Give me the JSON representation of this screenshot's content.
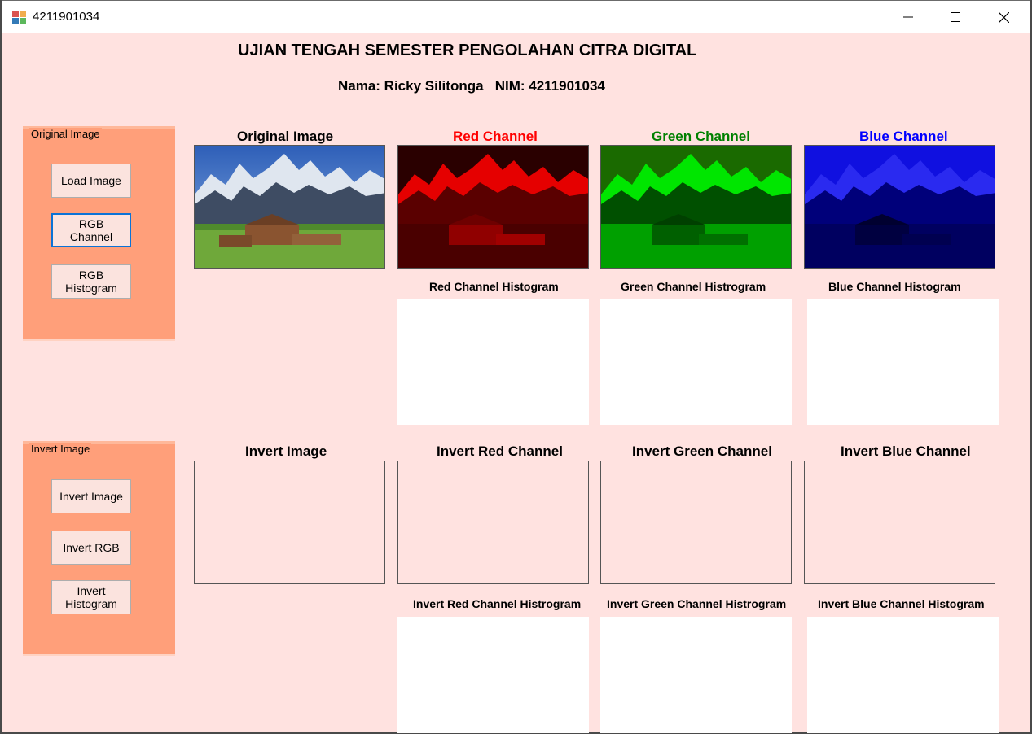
{
  "window": {
    "title": "4211901034"
  },
  "header": {
    "title": "UJIAN TENGAH SEMESTER PENGOLAHAN CITRA DIGITAL",
    "subtitle": "Nama: Ricky Silitonga   NIM: 4211901034"
  },
  "group_original": {
    "legend": "Original Image",
    "buttons": [
      "Load Image",
      "RGB Channel",
      "RGB Histogram"
    ]
  },
  "group_invert": {
    "legend": "Invert Image",
    "buttons": [
      "Invert Image",
      "Invert RGB",
      "Invert Histogram"
    ]
  },
  "captions": {
    "original": "Original Image",
    "red": "Red Channel",
    "green": "Green Channel",
    "blue": "Blue Channel",
    "red_hist": "Red Channel Histogram",
    "green_hist": "Green Channel Histrogram",
    "blue_hist": "Blue Channel Histogram",
    "invert": "Invert Image",
    "invert_red": "Invert Red Channel",
    "invert_green": "Invert Green Channel",
    "invert_blue": "Invert Blue Channel",
    "invert_red_hist": "Invert Red Channel Histrogram",
    "invert_green_hist": "Invert Green Channel Histrogram",
    "invert_blue_hist": "Invert Blue Channel Histogram"
  },
  "colors": {
    "form_bg": "#ffe2e0",
    "group_bg": "#ff9f7a",
    "red_caption": "#ff0000",
    "green_caption": "#008000",
    "blue_caption": "#0000ff",
    "focus_border": "#0b73d6"
  }
}
